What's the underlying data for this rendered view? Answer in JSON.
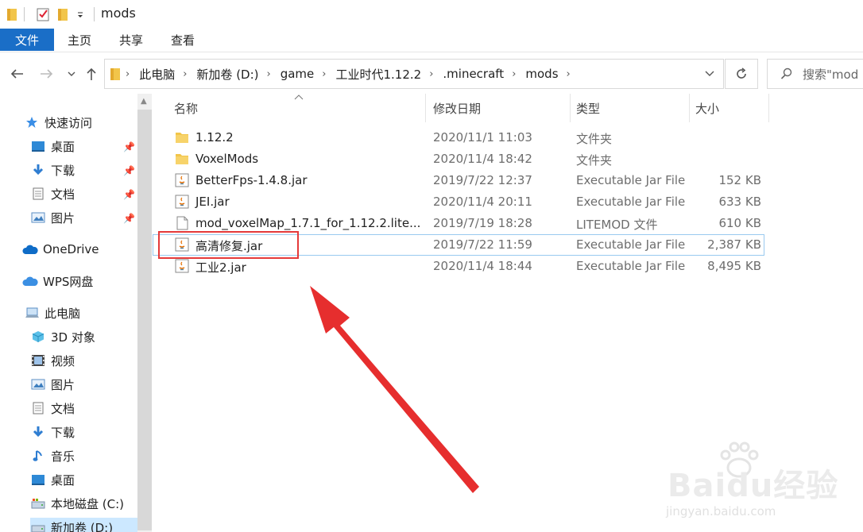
{
  "window": {
    "title": "mods"
  },
  "ribbon": {
    "tabs": [
      {
        "label": "文件",
        "active": true
      },
      {
        "label": "主页"
      },
      {
        "label": "共享"
      },
      {
        "label": "查看"
      }
    ]
  },
  "address": {
    "crumbs": [
      "此电脑",
      "新加卷 (D:)",
      "game",
      "工业时代1.12.2",
      ".minecraft",
      "mods"
    ]
  },
  "search": {
    "placeholder": "搜索\"mod"
  },
  "sidebar": {
    "items": [
      {
        "label": "快速访问",
        "icon": "star-icon"
      },
      {
        "label": "桌面",
        "icon": "desktop-icon",
        "pinned": true
      },
      {
        "label": "下载",
        "icon": "download-icon",
        "pinned": true
      },
      {
        "label": "文档",
        "icon": "document-icon",
        "pinned": true
      },
      {
        "label": "图片",
        "icon": "picture-icon",
        "pinned": true
      },
      {
        "label": "OneDrive",
        "icon": "cloud-icon"
      },
      {
        "label": "WPS网盘",
        "icon": "cloud-icon"
      },
      {
        "label": "此电脑",
        "icon": "computer-icon"
      },
      {
        "label": "3D 对象",
        "icon": "cube-icon"
      },
      {
        "label": "视频",
        "icon": "video-icon"
      },
      {
        "label": "图片",
        "icon": "picture-icon"
      },
      {
        "label": "文档",
        "icon": "document-icon"
      },
      {
        "label": "下载",
        "icon": "download-icon"
      },
      {
        "label": "音乐",
        "icon": "music-icon"
      },
      {
        "label": "桌面",
        "icon": "desktop-icon"
      },
      {
        "label": "本地磁盘 (C:)",
        "icon": "drive-icon"
      },
      {
        "label": "新加卷 (D:)",
        "icon": "drive-icon"
      }
    ]
  },
  "columns": {
    "name": "名称",
    "modified": "修改日期",
    "type": "类型",
    "size": "大小"
  },
  "files": [
    {
      "name": "1.12.2",
      "modified": "2020/11/1 11:03",
      "type": "文件夹",
      "size": "",
      "icon": "folder-icon"
    },
    {
      "name": "VoxelMods",
      "modified": "2020/11/4 18:42",
      "type": "文件夹",
      "size": "",
      "icon": "folder-icon"
    },
    {
      "name": "BetterFps-1.4.8.jar",
      "modified": "2019/7/22 12:37",
      "type": "Executable Jar File",
      "size": "152 KB",
      "icon": "java-jar-icon"
    },
    {
      "name": "JEI.jar",
      "modified": "2020/11/4 20:11",
      "type": "Executable Jar File",
      "size": "633 KB",
      "icon": "java-jar-icon"
    },
    {
      "name": "mod_voxelMap_1.7.1_for_1.12.2.lite...",
      "modified": "2019/7/19 18:28",
      "type": "LITEMOD 文件",
      "size": "610 KB",
      "icon": "file-icon"
    },
    {
      "name": "高清修复.jar",
      "modified": "2019/7/22 11:59",
      "type": "Executable Jar File",
      "size": "2,387 KB",
      "icon": "java-jar-icon",
      "selected": true
    },
    {
      "name": "工业2.jar",
      "modified": "2020/11/4 18:44",
      "type": "Executable Jar File",
      "size": "8,495 KB",
      "icon": "java-jar-icon"
    }
  ],
  "colors": {
    "accent": "#1a6ec7",
    "annotation": "#e53a3a",
    "folder": "#f2c54a"
  },
  "watermark": {
    "brand": "Baidu经验",
    "url": "jingyan.baidu.com"
  }
}
